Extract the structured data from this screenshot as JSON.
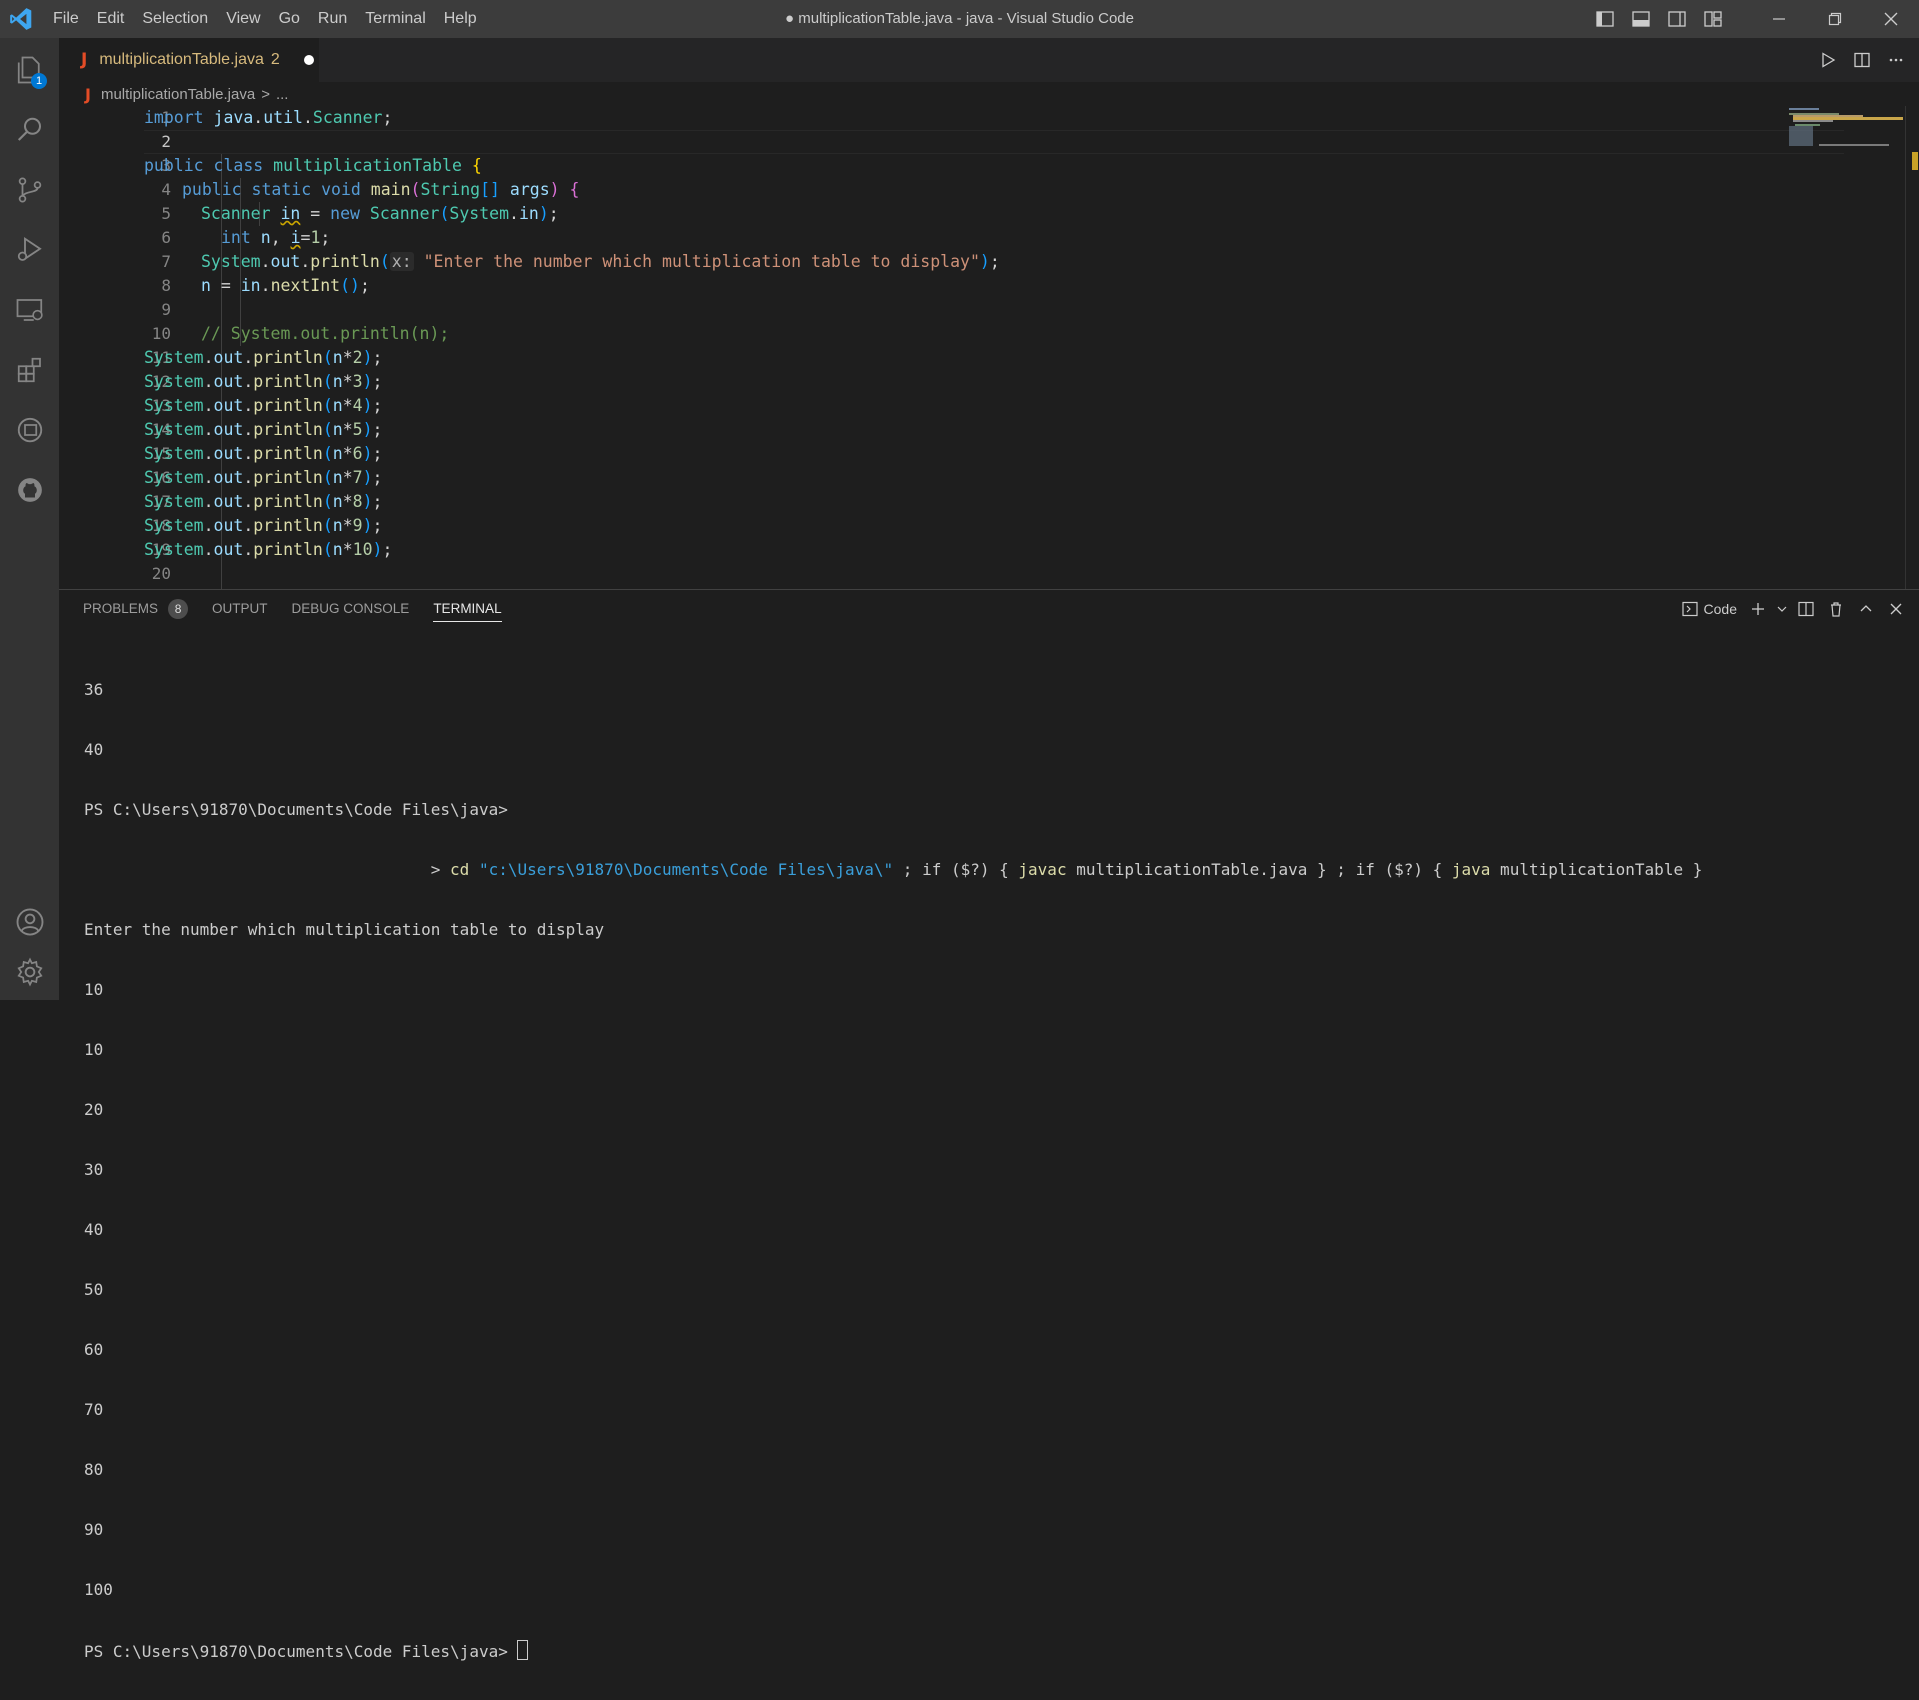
{
  "window": {
    "title": "● multiplicationTable.java - java - Visual Studio Code"
  },
  "menu": [
    "File",
    "Edit",
    "Selection",
    "View",
    "Go",
    "Run",
    "Terminal",
    "Help"
  ],
  "activity": {
    "explorer_badge": "1"
  },
  "tab": {
    "name": "multiplicationTable.java",
    "problem_count": "2",
    "icon_letter": "J"
  },
  "breadcrumb": {
    "file": "multiplicationTable.java",
    "separator": ">",
    "tail": "..."
  },
  "editor": {
    "current_line": 2,
    "line_numbers": [
      "1",
      "2",
      "3",
      "4",
      "5",
      "6",
      "7",
      "8",
      "9",
      "10",
      "11",
      "12",
      "13",
      "14",
      "15",
      "16",
      "17",
      "18",
      "19",
      "20"
    ],
    "code": {
      "l1": "import java.util.Scanner;",
      "l3": "public class multiplicationTable {",
      "l4": "public static void main(String[] args) {",
      "l5": "Scanner in = new Scanner(System.in);",
      "l6": "int n, i=1;",
      "l7_pre": "System.out.println(",
      "l7_hint": "x:",
      "l7_str": "\"Enter the number which multiplication table to display\"",
      "l7_post": ");",
      "l8": "n = in.nextInt();",
      "l10": "// System.out.println(n);",
      "println_prefix": "System.out.println(n*",
      "multipliers": [
        "2",
        "3",
        "4",
        "5",
        "6",
        "7",
        "8",
        "9",
        "10"
      ]
    }
  },
  "panel": {
    "tabs": [
      {
        "label": "PROBLEMS",
        "badge": "8"
      },
      {
        "label": "OUTPUT"
      },
      {
        "label": "DEBUG CONSOLE"
      },
      {
        "label": "TERMINAL",
        "active": true
      }
    ],
    "terminal_shell": "Code"
  },
  "terminal": {
    "lines_before": [
      "36",
      "40",
      "PS C:\\Users\\91870\\Documents\\Code Files\\java>"
    ],
    "command": {
      "prompt_indent": "                                    ",
      "gt": "> ",
      "cd": "cd",
      "path": "\"c:\\Users\\91870\\Documents\\Code Files\\java\\\"",
      "rest1": " ; if ($?) { ",
      "javac": "javac",
      "rest2": " multiplicationTable.java } ; if ($?) { ",
      "java": "java",
      "rest3": " multiplicationTable }"
    },
    "output": [
      "Enter the number which multiplication table to display",
      "10",
      "10",
      "20",
      "30",
      "40",
      "50",
      "60",
      "70",
      "80",
      "90",
      "100"
    ],
    "final_prompt": "PS C:\\Users\\91870\\Documents\\Code Files\\java> "
  }
}
